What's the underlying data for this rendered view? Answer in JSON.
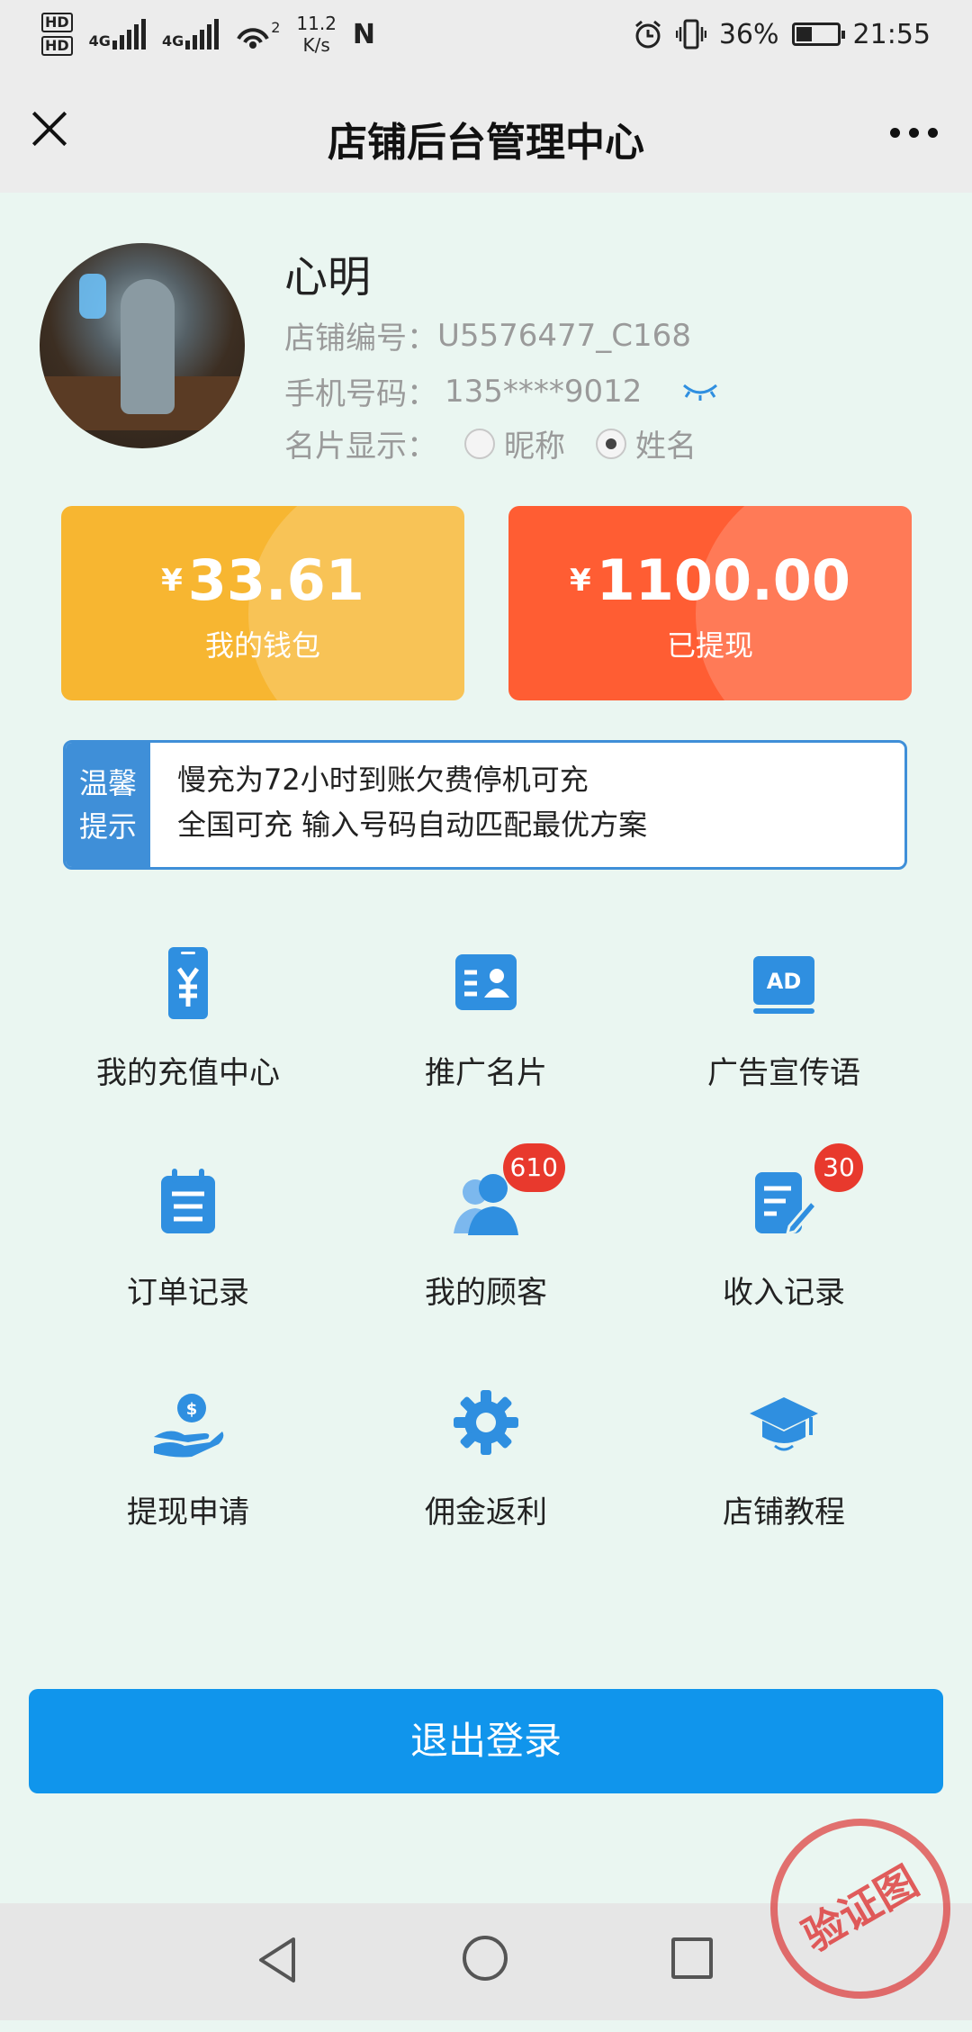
{
  "status_bar": {
    "hd1": "HD",
    "hd2": "HD",
    "net1": "4G",
    "net2": "4G",
    "wifi_count": "2",
    "speed_value": "11.2",
    "speed_unit": "K/s",
    "nfc": "N",
    "battery_percent": "36%",
    "time": "21:55"
  },
  "title_bar": {
    "title": "店铺后台管理中心"
  },
  "profile": {
    "name": "心明",
    "shop_id_label": "店铺编号：",
    "shop_id": "U5576477_C168",
    "phone_label": "手机号码：",
    "phone": "135****9012",
    "card_display_label": "名片显示：",
    "option_nickname": "昵称",
    "option_realname": "姓名",
    "selected_option": "姓名"
  },
  "cards": {
    "currency": "¥",
    "wallet_amount": "33.61",
    "wallet_label": "我的钱包",
    "withdrawn_amount": "1100.00",
    "withdrawn_label": "已提现",
    "wallet_color": "#f7b631",
    "withdrawn_color": "#ff5d33"
  },
  "notice": {
    "tag_line1": "温馨",
    "tag_line2": "提示",
    "line1": "慢充为72小时到账欠费停机可充",
    "line2": "全国可充 输入号码自动匹配最优方案"
  },
  "menu": {
    "items": [
      {
        "label": "我的充值中心",
        "icon": "yen-phone-icon"
      },
      {
        "label": "推广名片",
        "icon": "contact-card-icon"
      },
      {
        "label": "广告宣传语",
        "icon": "ad-icon",
        "icon_text": "AD"
      },
      {
        "label": "订单记录",
        "icon": "calendar-list-icon"
      },
      {
        "label": "我的顾客",
        "icon": "customers-icon",
        "badge": "610"
      },
      {
        "label": "收入记录",
        "icon": "edit-document-icon",
        "badge": "30"
      },
      {
        "label": "提现申请",
        "icon": "coin-hand-icon"
      },
      {
        "label": "佣金返利",
        "icon": "gear-icon"
      },
      {
        "label": "店铺教程",
        "icon": "graduation-cap-icon"
      }
    ],
    "icon_color": "#2f8fe0",
    "badge_color": "#e8392d"
  },
  "logout": {
    "label": "退出登录",
    "color": "#1095ec"
  },
  "watermark": {
    "text": "验证图"
  }
}
